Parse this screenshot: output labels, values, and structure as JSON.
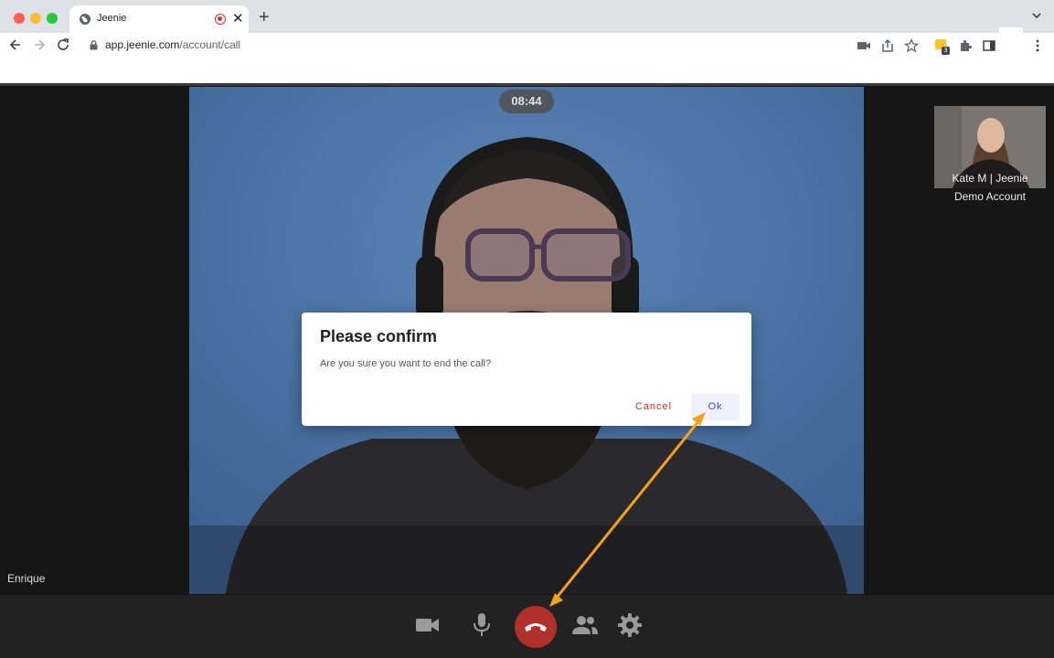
{
  "browser": {
    "tab_title": "Jeenie",
    "url_host": "app.jeenie.com",
    "url_path": "/account/call",
    "extension_badge": "3"
  },
  "call": {
    "timer": "08:44",
    "speaker_name": "Enrique",
    "self_view": {
      "name": "Kate M | Jeenie",
      "account": "Demo Account"
    }
  },
  "dialog": {
    "title": "Please confirm",
    "message": "Are you sure you want to end the call?",
    "cancel_label": "Cancel",
    "ok_label": "Ok"
  },
  "controls": [
    "camera-icon",
    "microphone-icon",
    "hang-up-icon",
    "participants-icon",
    "settings-icon"
  ],
  "colors": {
    "hangup": "#b0302c",
    "cancel": "#d32f2f",
    "ok": "#3f51b5",
    "annotation_arrow": "#f5a01e"
  }
}
